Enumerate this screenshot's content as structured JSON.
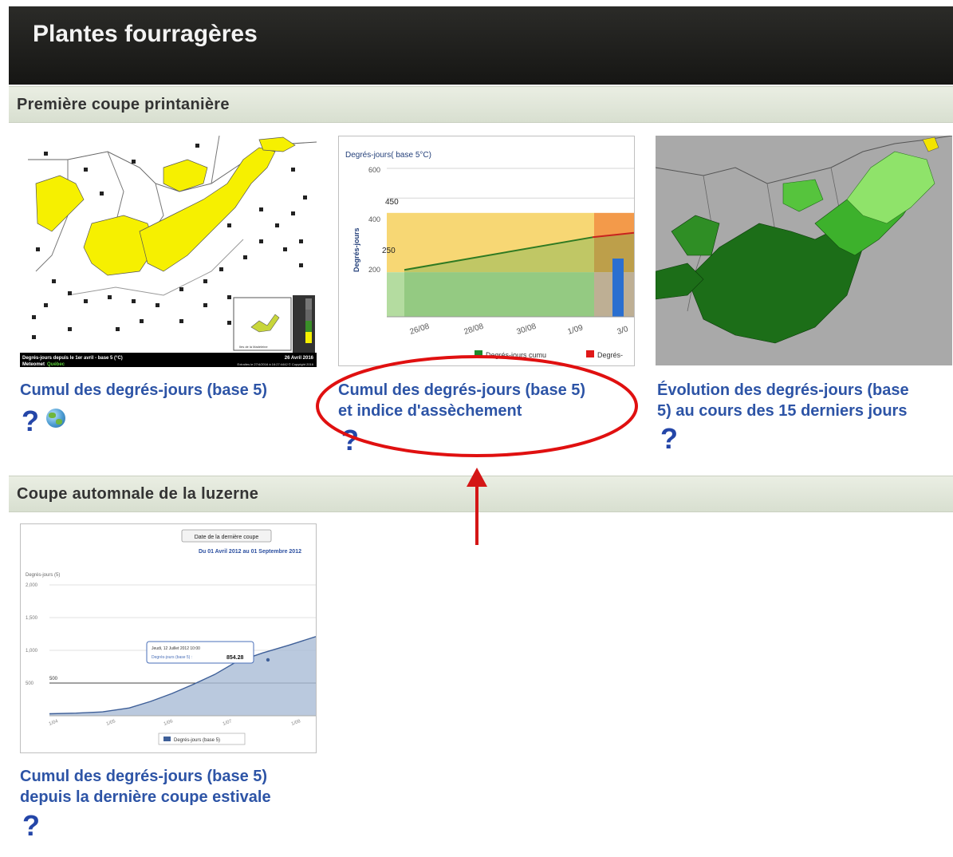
{
  "header": {
    "title": "Plantes fourragères"
  },
  "sections": [
    {
      "title": "Première coupe printanière",
      "cards": [
        {
          "title_lines": [
            "Cumul des degrés-jours (base 5)"
          ],
          "help": "?",
          "map": {
            "caption": "Degrés-jours depuis le 1er avril - base 5 (°C)",
            "date": "26 Avril 2016",
            "brand_a": "Meteomet",
            "brand_b": "Québec",
            "inset_label": "Iles de la Madeleine",
            "footer": "Extraites le 27/4/2016 à 16:27:4442    © Copyright 2016"
          }
        },
        {
          "title_lines": [
            "Cumul des degrés-jours (base 5)",
            "et indice d'assèchement"
          ],
          "help": "?",
          "chart": {
            "title": "Degrés-jours( base 5°C)",
            "ylabel": "Degrés-jours",
            "ytick_600": "600",
            "ytick_400": "400",
            "ytick_200": "200",
            "band_450": "450",
            "band_250": "250",
            "xticks": [
              "26/08",
              "28/08",
              "30/08",
              "1/09",
              "3/0"
            ],
            "legend1": "Degrés-jours cumu",
            "legend2": "Degrés-"
          }
        },
        {
          "title_lines": [
            "Évolution des degrés-jours (base",
            "5) au cours des 15 derniers jours"
          ],
          "help": "?"
        }
      ]
    },
    {
      "title": "Coupe automnale de la luzerne",
      "cards": [
        {
          "title_lines": [
            "Cumul des degrés-jours (base 5)",
            "depuis la dernière coupe estivale"
          ],
          "help": "?",
          "chart": {
            "button": "Date de la dernière coupe",
            "range": "Du 01 Avril 2012 au 01 Septembre 2012",
            "ylabel": "Degrés-jours (5)",
            "yticks": [
              "2,000",
              "1,500",
              "1,000",
              "500"
            ],
            "line_label": "500",
            "xticks": [
              "1/04",
              "1/05",
              "1/06",
              "1/07",
              "1/08"
            ],
            "tooltip_date": "Jeudi, 12 Juillet 2012 10:00",
            "tooltip_label": "Degrés-jours (base 5) :",
            "tooltip_value": "854.28",
            "legend": "Degrés-jours (base 5)"
          }
        }
      ]
    }
  ],
  "chart_data": [
    {
      "type": "area",
      "title": "Degrés-jours( base 5°C)",
      "ylabel": "Degrés-jours",
      "x": [
        "26/08",
        "28/08",
        "30/08",
        "1/09",
        "3/0"
      ],
      "ylim": [
        100,
        600
      ],
      "bands": [
        250,
        450
      ],
      "series": [
        {
          "name": "Degrés-jours cumu",
          "x": [
            "25/08",
            "1/09",
            "3/09"
          ],
          "values": [
            258,
            368,
            383
          ]
        }
      ]
    },
    {
      "type": "area",
      "ylabel": "Degrés-jours (5)",
      "x": [
        "1/04",
        "1/05",
        "1/06",
        "1/07",
        "1/08"
      ],
      "ylim": [
        0,
        2000
      ],
      "series": [
        {
          "name": "Degrés-jours (base 5)",
          "x_fraction": [
            0,
            0.1,
            0.2,
            0.3,
            0.38,
            0.46,
            0.54,
            0.62,
            0.7,
            0.8,
            0.9,
            1.0
          ],
          "values": [
            30,
            40,
            60,
            120,
            220,
            340,
            480,
            630,
            820,
            960,
            1080,
            1210
          ]
        }
      ],
      "annotations": [
        {
          "label": "Jeudi, 12 Juillet 2012 10:00",
          "value": 854.28
        }
      ]
    }
  ],
  "annotation": {
    "circle_color": "#e01010",
    "arrow_color": "#d41616"
  },
  "colors": {
    "link": "#2d54a6",
    "help": "#2446a8",
    "topbar": "#1e1e1c"
  }
}
